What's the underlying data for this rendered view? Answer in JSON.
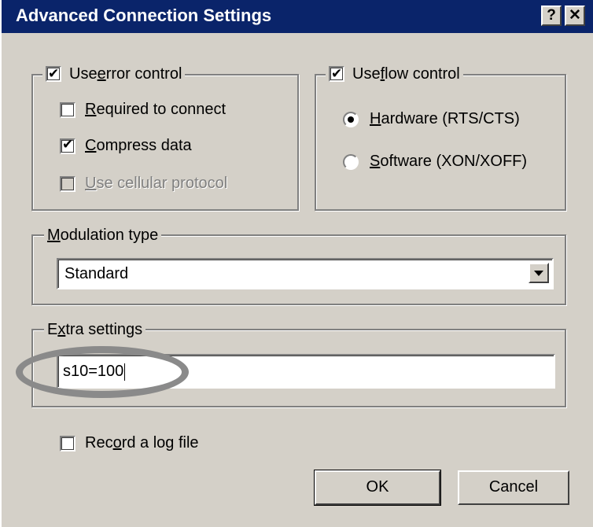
{
  "window": {
    "title": "Advanced Connection Settings",
    "help_button": "?",
    "close_button": "✕"
  },
  "error_control": {
    "label_pre": "Use ",
    "label_key": "e",
    "label_post": "rror control",
    "checked": true,
    "options": {
      "required": {
        "key": "R",
        "rest": "equired to connect",
        "checked": false
      },
      "compress": {
        "key": "C",
        "rest": "ompress data",
        "checked": true
      },
      "cellular": {
        "key": "U",
        "rest": "se cellular protocol",
        "checked": false,
        "disabled": true
      }
    }
  },
  "flow_control": {
    "label_pre": "Use ",
    "label_key": "f",
    "label_post": "low control",
    "checked": true,
    "hardware": {
      "key": "H",
      "rest": "ardware (RTS/CTS)",
      "selected": true
    },
    "software": {
      "key": "S",
      "rest": "oftware (XON/XOFF)",
      "selected": false
    }
  },
  "modulation": {
    "label_key": "M",
    "label_rest": "odulation type",
    "selected": "Standard"
  },
  "extra": {
    "label_pre": "E",
    "label_key": "x",
    "label_rest": "tra settings",
    "value": "s10=100"
  },
  "log": {
    "label_pre": "Rec",
    "label_key": "o",
    "label_rest": "rd a log file",
    "checked": false
  },
  "buttons": {
    "ok": "OK",
    "cancel": "Cancel"
  }
}
